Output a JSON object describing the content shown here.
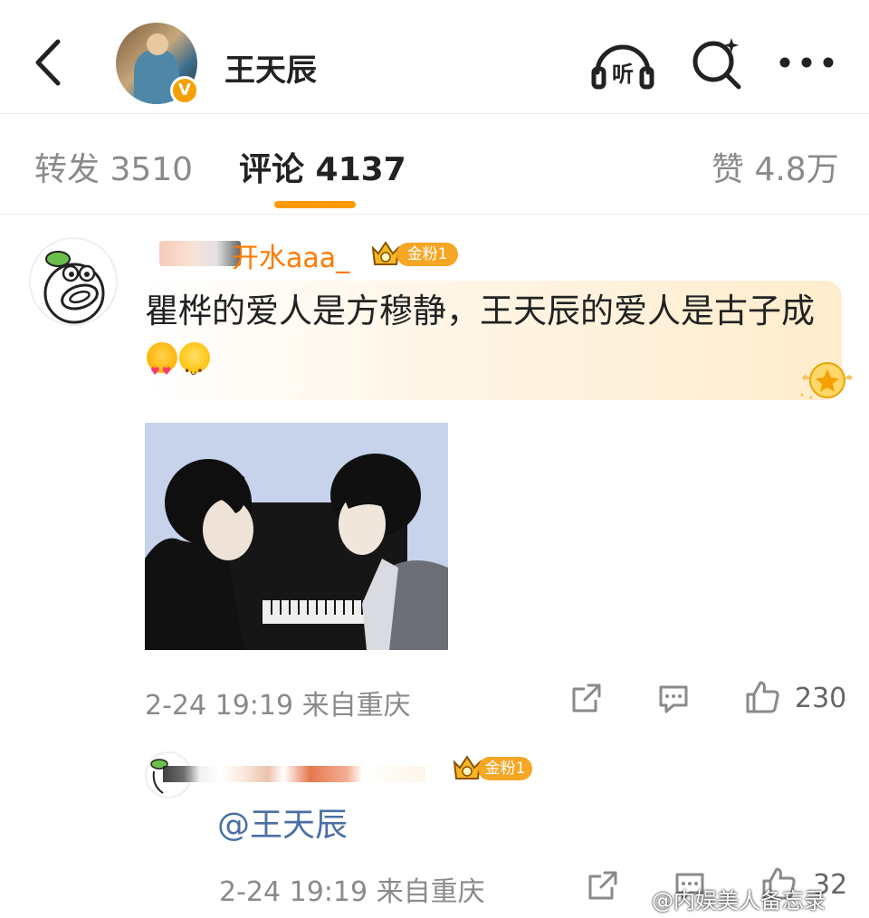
{
  "header": {
    "title": "王天辰",
    "verified_mark": "V",
    "listen_label": "听",
    "icons": [
      "back-icon",
      "listen-icon",
      "search-icon",
      "more-icon"
    ]
  },
  "tabs": [
    {
      "label": "转发 3510"
    },
    {
      "label": "评论 4137",
      "active": true
    },
    {
      "label": "赞 4.8万"
    }
  ],
  "comment": {
    "username": "开水aaa_",
    "fan_badge": "金粉1",
    "text": "瞿桦的爱人是方穆静，王天辰的爱人是古子成",
    "emojis": [
      "love-eyes-emoji",
      "shy-emoji"
    ],
    "meta": "2-24 19:19 来自重庆",
    "like_count": "230"
  },
  "reply": {
    "fan_badge": "金粉1",
    "mention": "@王天辰",
    "meta": "2-24 19:19 来自重庆",
    "like_count": "32"
  },
  "watermark": "@内娱美人备忘录",
  "colors": {
    "accent": "#ff9a00",
    "username": "#ff7a00",
    "mention": "#4a6fa5",
    "badge": "#f5a623",
    "muted": "#8a8a8a"
  }
}
